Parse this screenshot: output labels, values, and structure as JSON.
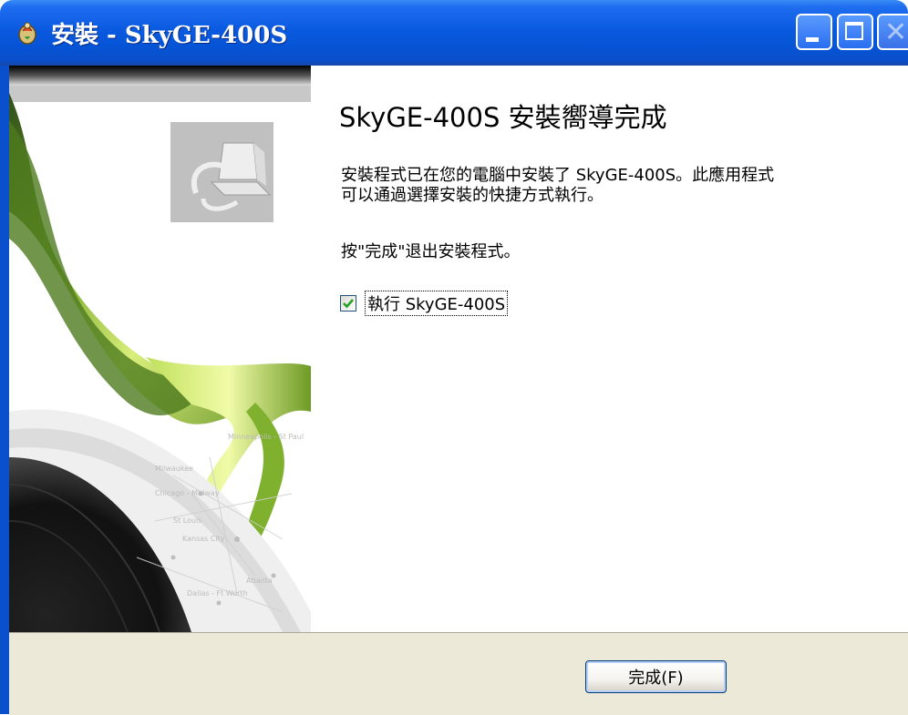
{
  "window": {
    "title": "安裝 - SkyGE-400S"
  },
  "content": {
    "heading": "SkyGE-400S 安裝嚮導完成",
    "description_line1": "安裝程式已在您的電腦中安裝了 SkyGE-400S。此應用程式",
    "description_line2": "可以通過選擇安裝的快捷方式執行。",
    "instruction": "按\"完成\"退出安裝程式。",
    "run_checkbox": {
      "label": "執行 SkyGE-400S",
      "checked": true
    }
  },
  "banner": {
    "map_labels": [
      "Minneapolis - St Paul",
      "Milwaukee",
      "Chicago - Midway",
      "St Louis",
      "Kansas City",
      "Atlanta",
      "Dallas - Ft Worth"
    ]
  },
  "footer": {
    "finish_label": "完成(F)"
  },
  "colors": {
    "titlebar": "#0a5ae0",
    "footer_bg": "#ece9d8",
    "ribbon_green": "#8fbf3a"
  },
  "icons": [
    "setup-icon",
    "minimize-icon",
    "maximize-icon",
    "close-icon",
    "computer-install-icon",
    "checkmark-icon"
  ]
}
